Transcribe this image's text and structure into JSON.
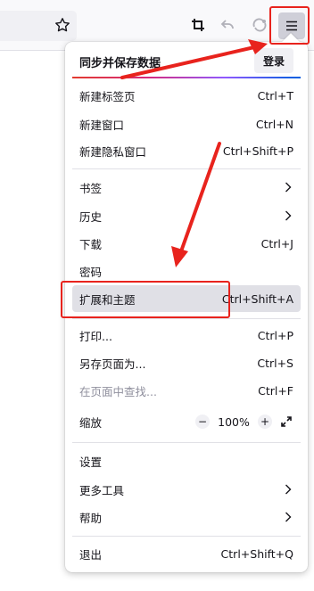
{
  "panel": {
    "sync_title": "同步并保存数据",
    "login_label": "登录"
  },
  "items": [
    {
      "label": "新建标签页",
      "shortcut": "Ctrl+T"
    },
    {
      "label": "新建窗口",
      "shortcut": "Ctrl+N"
    },
    {
      "label": "新建隐私窗口",
      "shortcut": "Ctrl+Shift+P"
    },
    {
      "label": "书签",
      "shortcut": ""
    },
    {
      "label": "历史",
      "shortcut": ""
    },
    {
      "label": "下载",
      "shortcut": "Ctrl+J"
    },
    {
      "label": "密码",
      "shortcut": ""
    },
    {
      "label": "扩展和主题",
      "shortcut": "Ctrl+Shift+A"
    },
    {
      "label": "打印...",
      "shortcut": "Ctrl+P"
    },
    {
      "label": "另存页面为...",
      "shortcut": "Ctrl+S"
    },
    {
      "label": "在页面中查找...",
      "shortcut": "Ctrl+F"
    },
    {
      "label": "缩放",
      "shortcut": ""
    },
    {
      "label": "设置",
      "shortcut": ""
    },
    {
      "label": "更多工具",
      "shortcut": ""
    },
    {
      "label": "帮助",
      "shortcut": ""
    },
    {
      "label": "退出",
      "shortcut": "Ctrl+Shift+Q"
    }
  ],
  "zoom": {
    "minus": "−",
    "value": "100%",
    "plus": "+"
  },
  "colors": {
    "accent_red": "#e8231d",
    "highlight": "#e0e0e6"
  }
}
